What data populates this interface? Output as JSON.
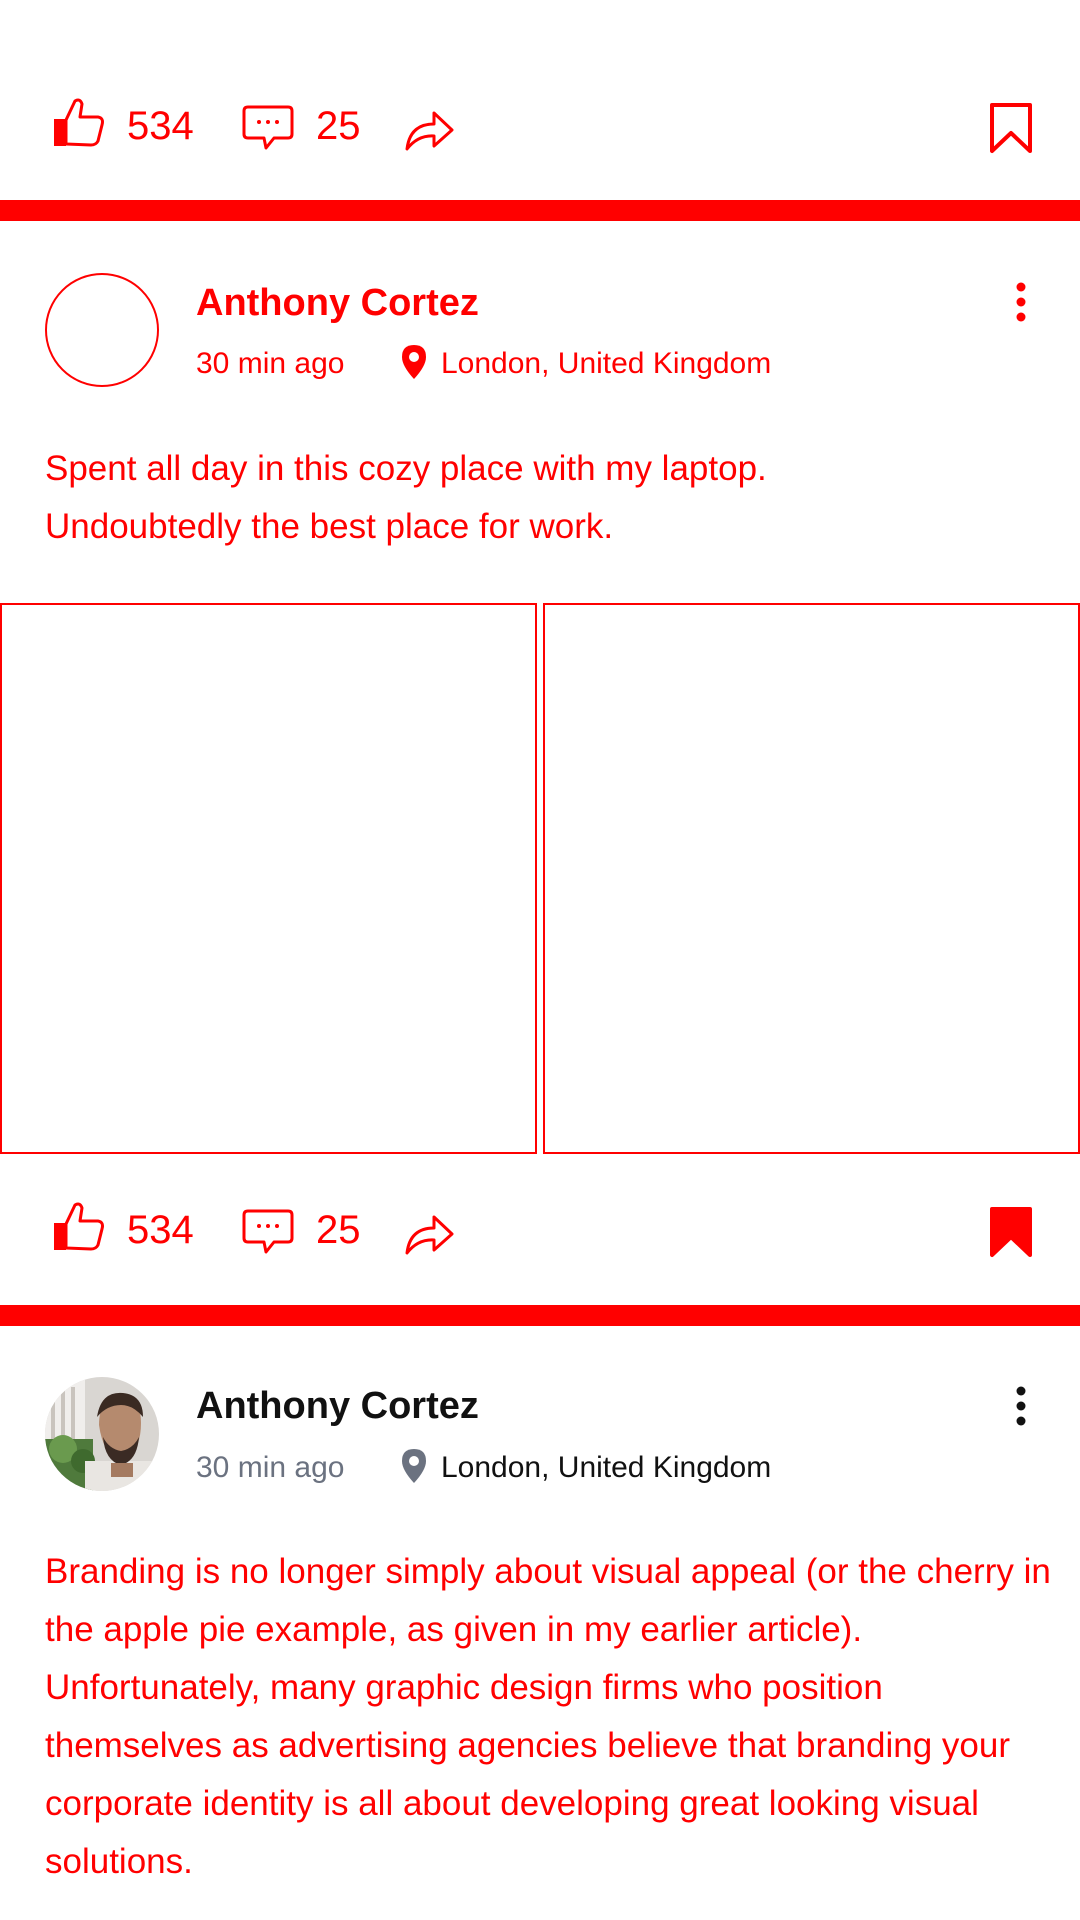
{
  "colors": {
    "accent": "#ff0000",
    "dark": "#111111",
    "muted": "#6b7280"
  },
  "top_actions": {
    "likes": "534",
    "comments": "25",
    "bookmarked": false
  },
  "posts": [
    {
      "author": "Anthony Cortez",
      "time": "30 min ago",
      "location": "London, United Kingdom",
      "text": "Spent all day in this cozy place with my laptop. Undoubtedly the best place for work.",
      "actions": {
        "likes": "534",
        "comments": "25",
        "bookmarked": true
      },
      "icons": [
        "thumbs-up-icon",
        "comment-icon",
        "share-icon",
        "bookmark-icon",
        "more-vertical-icon",
        "location-pin-icon"
      ]
    },
    {
      "author": "Anthony Cortez",
      "time": "30 min ago",
      "location": "London, United Kingdom",
      "text": "Branding is no longer simply about visual appeal (or the cherry in the apple pie example, as given in my earlier article). Unfortunately, many graphic design firms who position themselves as advertising agencies believe that branding your corporate identity is all about developing great looking visual solutions."
    }
  ]
}
